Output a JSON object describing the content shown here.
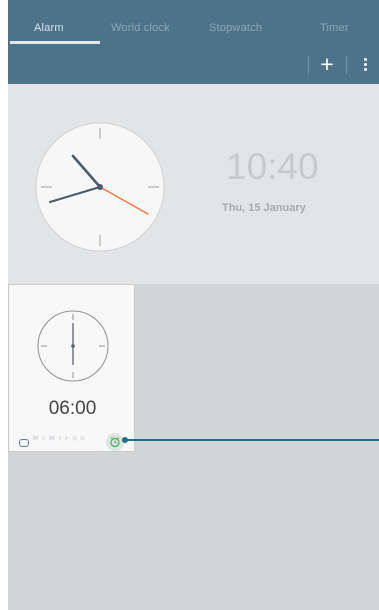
{
  "tabs": [
    "Alarm",
    "World clock",
    "Stopwatch",
    "Timer"
  ],
  "active_tab": "Alarm",
  "actions": {
    "add_label": "+"
  },
  "clock": {
    "time": "10:40",
    "date": "Thu, 15 January"
  },
  "alarms": [
    {
      "time": "06:00",
      "days": "M T W T F S S"
    }
  ],
  "colors": {
    "header": "#4d738b",
    "accent_second_hand": "#e8743a",
    "callout": "#1b6f8c",
    "alarm_on": "#3fae5a"
  }
}
